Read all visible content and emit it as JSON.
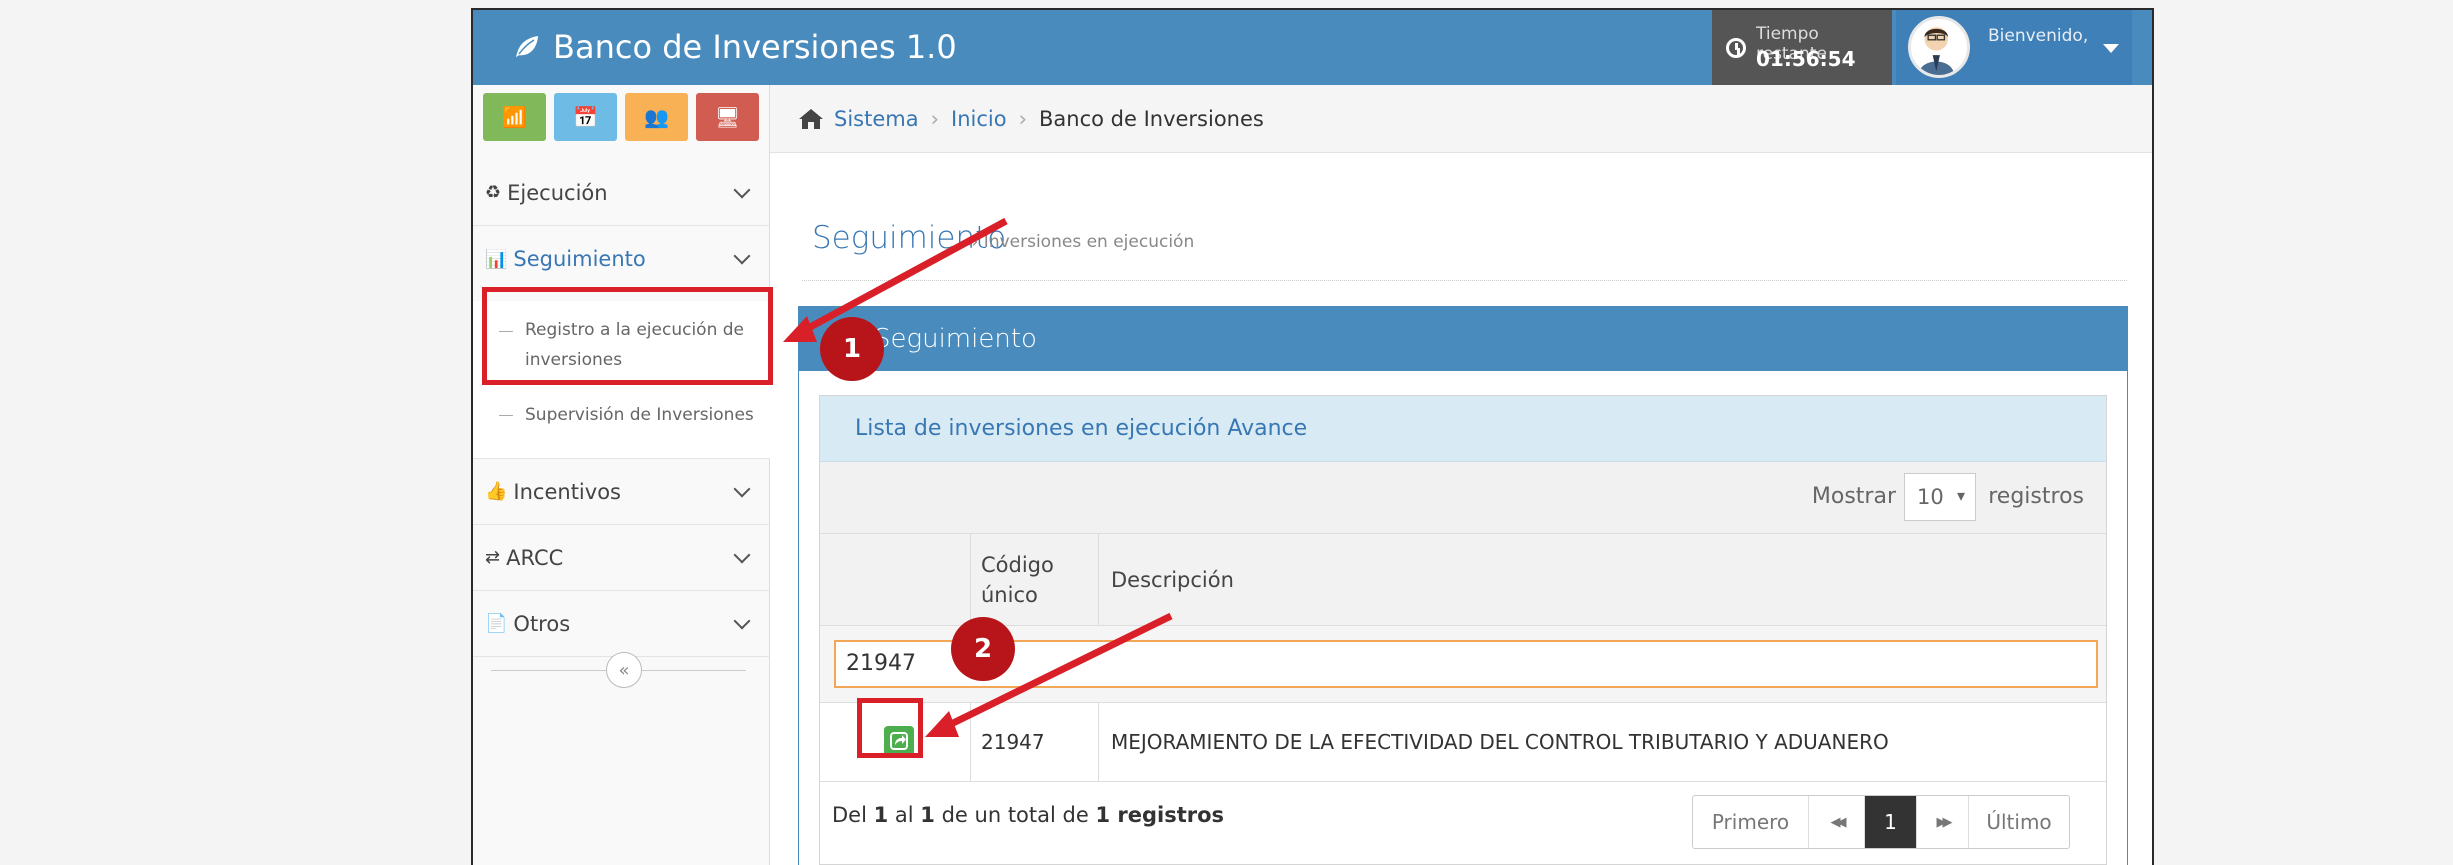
{
  "app": {
    "title": "Banco de Inversiones 1.0",
    "logo_icon": "leaf-icon"
  },
  "timer": {
    "label": "Tiempo restante",
    "value": "01:56:54"
  },
  "user": {
    "greeting": "Bienvenido,"
  },
  "sidebar": {
    "shortcuts": [
      {
        "icon": "signal-icon",
        "glyph": "📶",
        "color": "#81b95a"
      },
      {
        "icon": "calendar-icon",
        "glyph": "📅",
        "color": "#6ebbe6"
      },
      {
        "icon": "users-icon",
        "glyph": "👥",
        "color": "#f8b155"
      },
      {
        "icon": "monitor-icon",
        "glyph": "🖥",
        "color": "#d15d52"
      }
    ],
    "items": [
      {
        "label": "Ejecución",
        "glyph": "♻"
      },
      {
        "label": "Seguimiento",
        "glyph": "📊"
      },
      {
        "label": "Incentivos",
        "glyph": "👍"
      },
      {
        "label": "ARCC",
        "glyph": "⇄"
      },
      {
        "label": "Otros",
        "glyph": "📄"
      }
    ],
    "sub_items": [
      {
        "label_line1": "Registro a la ejecución de",
        "label_line2": "inversiones"
      },
      {
        "label": "Supervisión de Inversiones"
      }
    ],
    "collapse_glyph": "«"
  },
  "breadcrumb": {
    "items": [
      "Sistema",
      "Inicio",
      "Banco de Inversiones"
    ],
    "separator": "›"
  },
  "page": {
    "title": "Seguimiento",
    "subtitle": "» Inversiones en ejecución"
  },
  "panel": {
    "title": "Seguimiento"
  },
  "list": {
    "title": "Lista de inversiones en ejecución Avance",
    "show_label": "Mostrar",
    "show_value": "10",
    "show_after": "registros",
    "columns": {
      "code_line1": "Código",
      "code_line2": "único",
      "description": "Descripción"
    },
    "filter_value": "21947",
    "rows": [
      {
        "code": "21947",
        "description": "MEJORAMIENTO DE LA EFECTIVIDAD DEL CONTROL TRIBUTARIO Y ADUANERO"
      }
    ],
    "info": {
      "p1": "Del ",
      "from": "1",
      "p2": " al ",
      "to": "1",
      "p3": " de un total de ",
      "total": "1",
      "p4": " registros"
    },
    "pager": {
      "first": "Primero",
      "prev": "◀◀",
      "current": "1",
      "next": "▶▶",
      "last": "Último"
    }
  },
  "annotations": {
    "step1": "1",
    "step2": "2",
    "color": "#d92028"
  }
}
